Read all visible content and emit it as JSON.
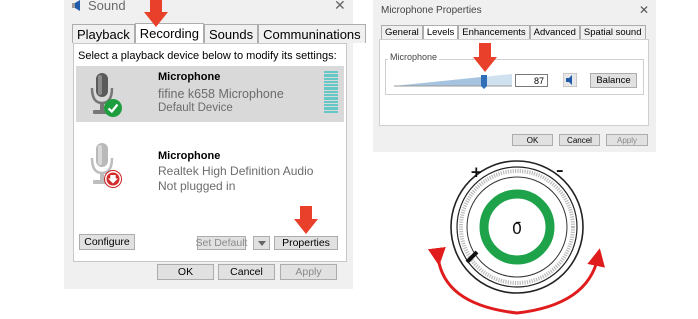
{
  "sound_dialog": {
    "title": "Sound",
    "close_glyph": "✕",
    "tabs": [
      "Playback",
      "Recording",
      "Sounds",
      "Communinations"
    ],
    "active_tab": "Recording",
    "instruction": "Select a playback device below to modify its settings:",
    "devices": [
      {
        "name": "Microphone",
        "line1": "fifine k658 Microphone",
        "line2": "Default Device",
        "status_icon": "check-icon",
        "selected": true
      },
      {
        "name": "Microphone",
        "line1": "Realtek High Definition Audio",
        "line2": "Not plugged in",
        "status_icon": "unplugged-arrow-icon",
        "selected": false
      }
    ],
    "buttons": {
      "configure": "Configure",
      "set_default": "Set Default",
      "properties": "Properties",
      "ok": "OK",
      "cancel": "Cancel",
      "apply": "Apply"
    }
  },
  "properties_dialog": {
    "title": "Microphone Properties",
    "close_glyph": "✕",
    "tabs": [
      "General",
      "Levels",
      "Enhancements",
      "Advanced",
      "Spatial sound"
    ],
    "active_tab": "Levels",
    "group_label": "Microphone",
    "level_value": "87",
    "level_fraction": 0.87,
    "buttons": {
      "balance": "Balance",
      "ok": "OK",
      "cancel": "Cancel",
      "apply": "Apply"
    }
  },
  "knob": {
    "plus_label": "+",
    "minus_label": "–",
    "center_glyph": "0̄"
  },
  "colors": {
    "arrow": "#e8402a",
    "ring": "#1ea34a",
    "meter": "#66c7c7",
    "slider_thumb": "#2f6fb7",
    "rotate_arrow": "#e01c1c"
  }
}
